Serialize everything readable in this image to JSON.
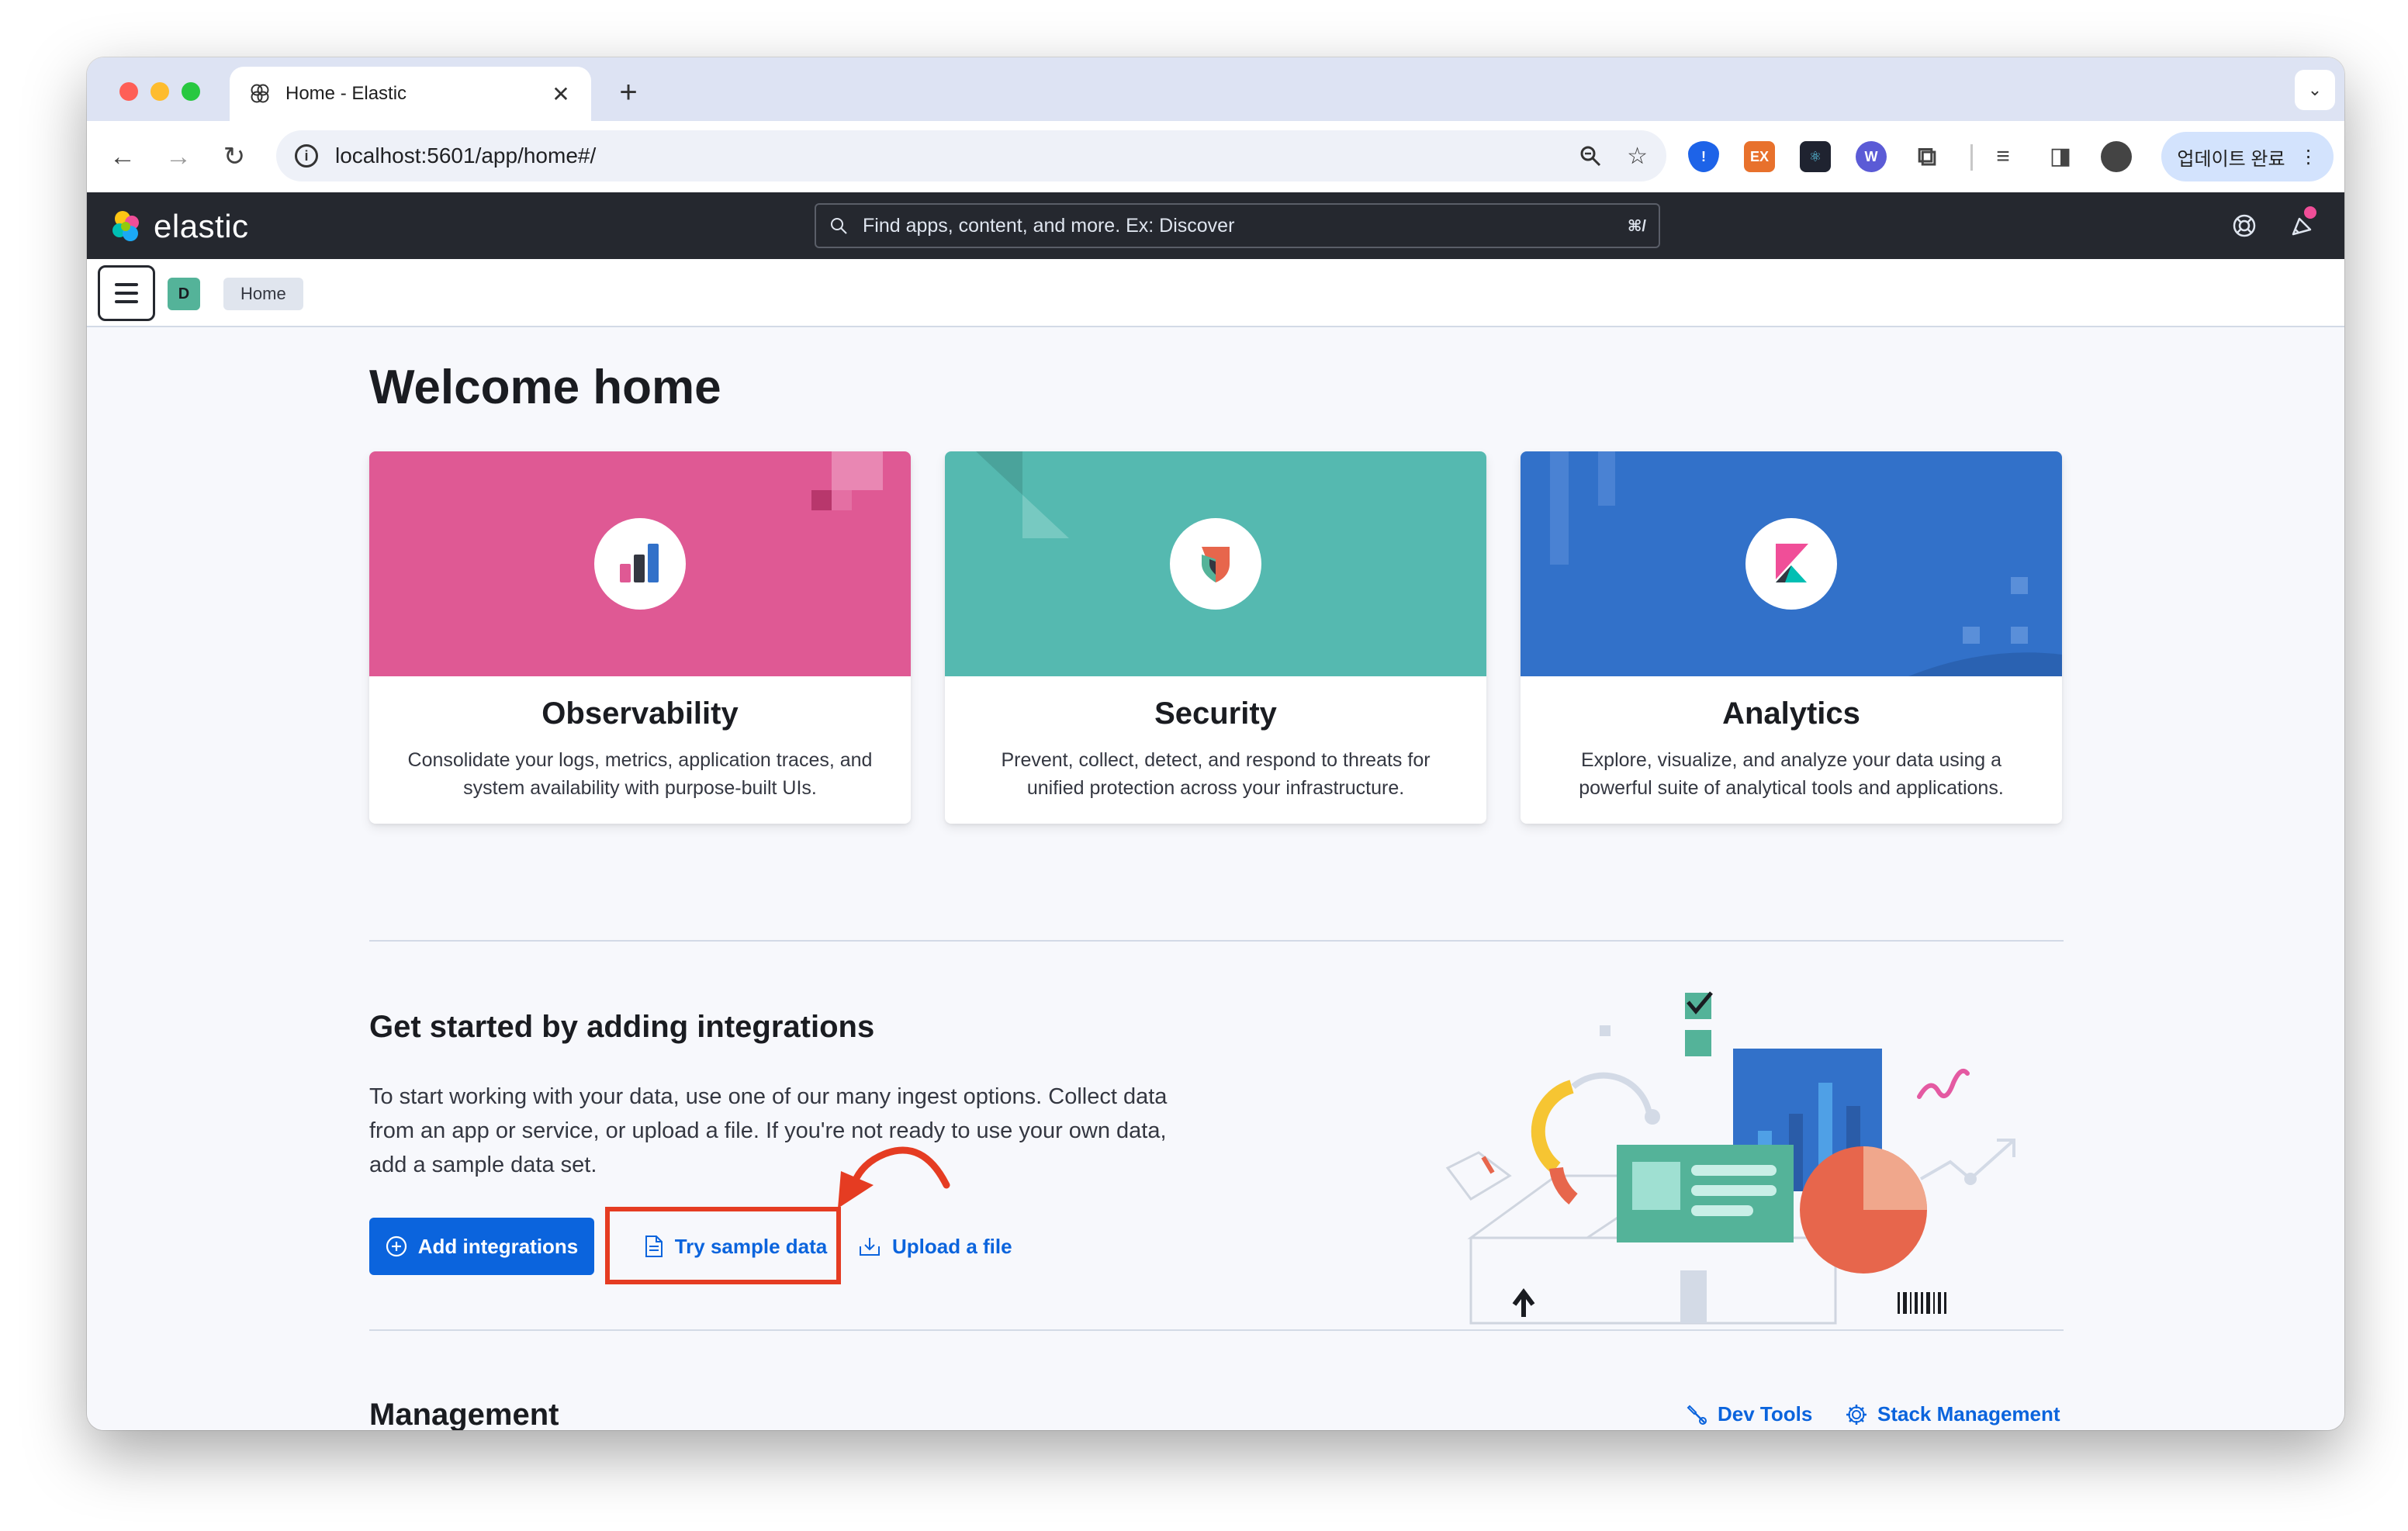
{
  "browser": {
    "tab_title": "Home - Elastic",
    "tab_close": "✕",
    "new_tab": "+",
    "tab_menu": "⌄",
    "url": "localhost:5601/app/home#/",
    "update_label": "업데이트 완료",
    "update_menu": "⋮"
  },
  "header": {
    "brand": "elastic",
    "search_placeholder": "Find apps, content, and more. Ex: Discover",
    "search_shortcut": "⌘/"
  },
  "breadcrumb": {
    "space_initial": "D",
    "items": [
      {
        "label": "Home"
      }
    ]
  },
  "page": {
    "title": "Welcome home"
  },
  "solutions": [
    {
      "title": "Observability",
      "description": "Consolidate your logs, metrics, application traces, and system availability with purpose-built UIs.",
      "color": "#df5994"
    },
    {
      "title": "Security",
      "description": "Prevent, collect, detect, and respond to threats for unified protection across your infrastructure.",
      "color": "#55b9b0"
    },
    {
      "title": "Analytics",
      "description": "Explore, visualize, and analyze your data using a powerful suite of analytical tools and applications.",
      "color": "#3271c9"
    }
  ],
  "integrations": {
    "title": "Get started by adding integrations",
    "description": "To start working with your data, use one of our many ingest options. Collect data from an app or service, or upload a file. If you're not ready to use your own data, add a sample data set.",
    "add_label": "Add integrations",
    "sample_label": "Try sample data",
    "upload_label": "Upload a file"
  },
  "management": {
    "title": "Management",
    "dev_tools_label": "Dev Tools",
    "stack_label": "Stack Management"
  },
  "colors": {
    "accent": "#0b64dd",
    "annotation": "#e53c22",
    "header_bg": "#25282f"
  }
}
